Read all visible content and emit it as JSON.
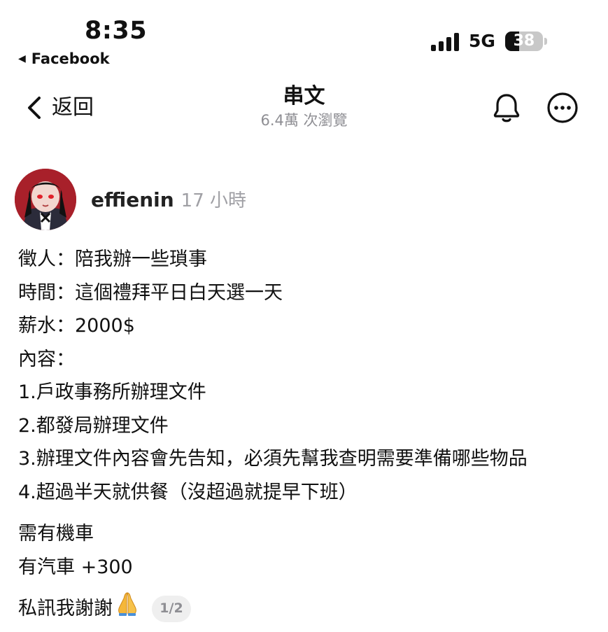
{
  "status_bar": {
    "time": "8:35",
    "back_app": "Facebook",
    "network": "5G",
    "battery_percent": "38",
    "battery_level": 0.38,
    "signal_bars": 4
  },
  "header": {
    "back_label": "返回",
    "title": "串文",
    "views": "6.4萬 次瀏覽",
    "icons": [
      "chevron-left-icon",
      "bell-icon",
      "more-icon"
    ]
  },
  "post": {
    "username": "effienin",
    "timestamp": "17 小時",
    "lines": [
      "徵人：陪我辦一些瑣事",
      "時間：這個禮拜平日白天選一天",
      "薪水：2000$",
      "內容：",
      "1.戶政事務所辦理文件",
      "2.都發局辦理文件",
      "3.辦理文件內容會先告知，必須先幫我查明需要準備哪些物品",
      "4.超過半天就供餐（沒超過就提早下班）"
    ],
    "extra_lines": [
      "需有機車",
      "有汽車 +300"
    ],
    "closing": "私訊我謝謝",
    "closing_emoji": "folded-hands-emoji",
    "page_indicator": "1/2"
  }
}
